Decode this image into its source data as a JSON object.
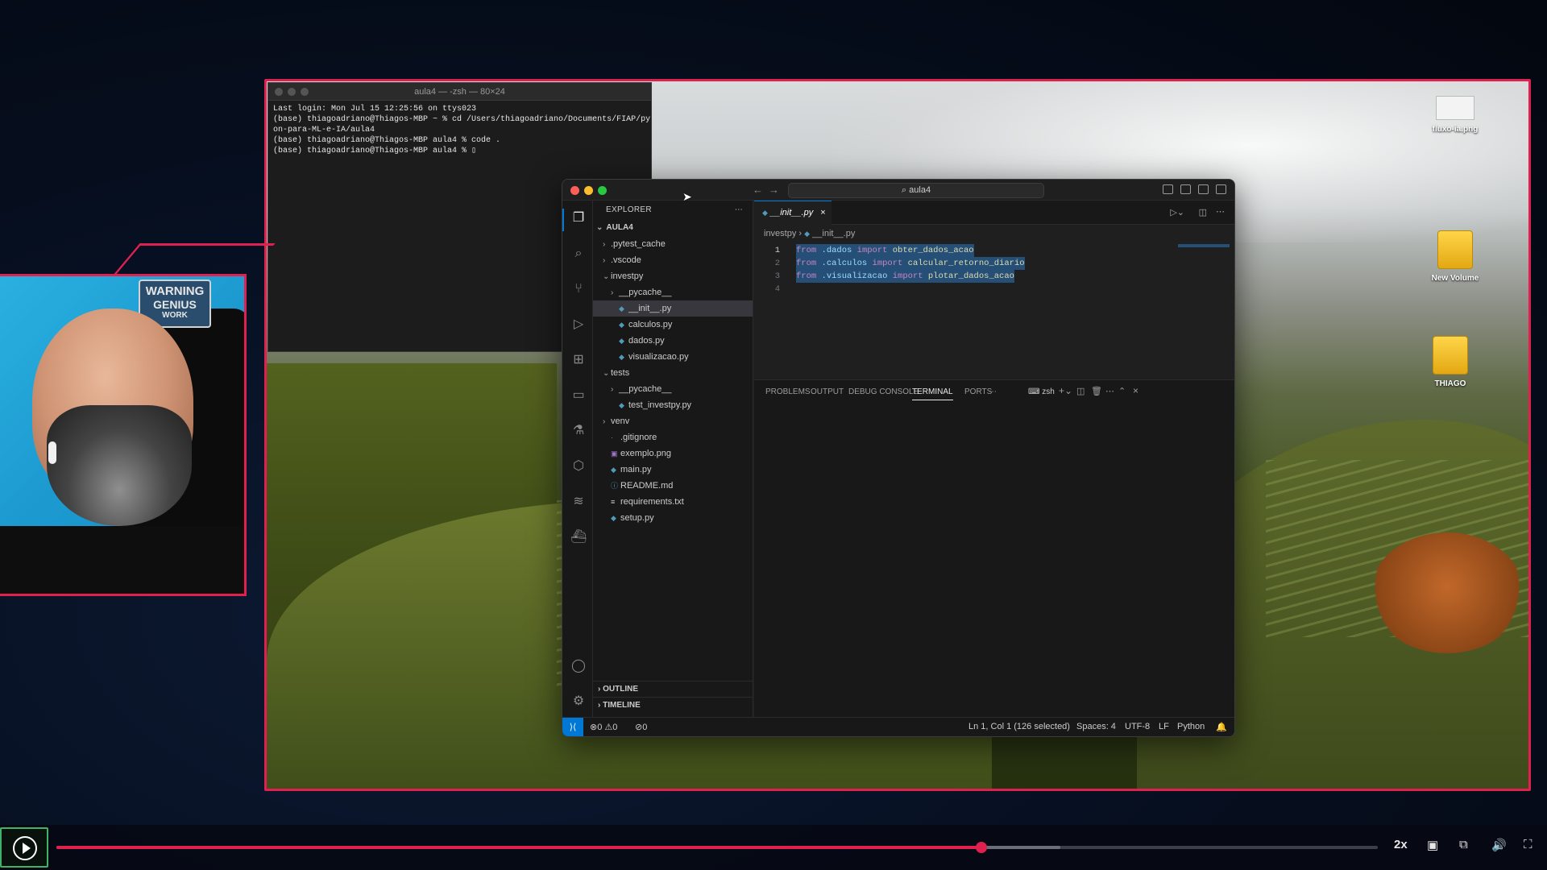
{
  "terminal": {
    "title": "aula4 — -zsh — 80×24",
    "lines": [
      "Last login: Mon Jul 15 12:25:56 on ttys023",
      "(base) thiagoadriano@Thiagos-MBP ~ % cd /Users/thiagoadriano/Documents/FIAP/pyth",
      "on-para-ML-e-IA/aula4",
      "(base) thiagoadriano@Thiagos-MBP aula4 % code .",
      "(base) thiagoadriano@Thiagos-MBP aula4 % ▯"
    ]
  },
  "vscode": {
    "search": "aula4",
    "explorer_title": "EXPLORER",
    "root": "AULA4",
    "tree": [
      {
        "label": ".pytest_cache",
        "type": "folder",
        "depth": 1,
        "open": false
      },
      {
        "label": ".vscode",
        "type": "folder",
        "depth": 1,
        "open": false
      },
      {
        "label": "investpy",
        "type": "folder",
        "depth": 1,
        "open": true
      },
      {
        "label": "__pycache__",
        "type": "folder",
        "depth": 2,
        "open": false
      },
      {
        "label": "__init__.py",
        "type": "py",
        "depth": 2,
        "selected": true
      },
      {
        "label": "calculos.py",
        "type": "py",
        "depth": 2
      },
      {
        "label": "dados.py",
        "type": "py",
        "depth": 2
      },
      {
        "label": "visualizacao.py",
        "type": "py",
        "depth": 2
      },
      {
        "label": "tests",
        "type": "folder",
        "depth": 1,
        "open": true
      },
      {
        "label": "__pycache__",
        "type": "folder",
        "depth": 2,
        "open": false
      },
      {
        "label": "test_investpy.py",
        "type": "py",
        "depth": 2
      },
      {
        "label": "venv",
        "type": "folder",
        "depth": 1,
        "open": false
      },
      {
        "label": ".gitignore",
        "type": "file",
        "depth": 1
      },
      {
        "label": "exemplo.png",
        "type": "img",
        "depth": 1
      },
      {
        "label": "main.py",
        "type": "py",
        "depth": 1
      },
      {
        "label": "README.md",
        "type": "md",
        "depth": 1
      },
      {
        "label": "requirements.txt",
        "type": "txt",
        "depth": 1
      },
      {
        "label": "setup.py",
        "type": "py",
        "depth": 1
      }
    ],
    "outline": "OUTLINE",
    "timeline": "TIMELINE",
    "tab": "__init__.py",
    "breadcrumb_folder": "investpy",
    "breadcrumb_file": "__init__.py",
    "code": [
      {
        "n": "1",
        "kw1": "from",
        "mod": " .dados ",
        "kw2": "import",
        "fn": " obter_dados_acao"
      },
      {
        "n": "2",
        "kw1": "from",
        "mod": " .calculos ",
        "kw2": "import",
        "fn": " calcular_retorno_diario"
      },
      {
        "n": "3",
        "kw1": "from",
        "mod": " .visualizacao ",
        "kw2": "import",
        "fn": " plotar_dados_acao"
      },
      {
        "n": "4",
        "kw1": "",
        "mod": "",
        "kw2": "",
        "fn": ""
      }
    ],
    "panel_tabs": [
      "PROBLEMS",
      "OUTPUT",
      "DEBUG CONSOLE",
      "TERMINAL",
      "PORTS"
    ],
    "panel_active": "TERMINAL",
    "panel_shell": "zsh",
    "status": {
      "errors": "0",
      "warnings": "0",
      "ports": "0",
      "position": "Ln 1, Col 1 (126 selected)",
      "spaces": "Spaces: 4",
      "encoding": "UTF-8",
      "eol": "LF",
      "language": "Python"
    }
  },
  "desktop_icons": [
    {
      "label": "fluxo-ia.png",
      "icon": "image-file-icon"
    },
    {
      "label": "New Volume",
      "icon": "drive-icon"
    },
    {
      "label": "THIAGO",
      "icon": "drive-icon"
    }
  ],
  "webcam": {
    "sign_line1": "WARNING",
    "sign_line2": "GENIUS",
    "sign_line3": "WORK"
  },
  "player": {
    "progress": 0.7,
    "buffered": 0.76,
    "speed": "2x"
  },
  "colors": {
    "accent": "#e0214f",
    "vscode_blue": "#0078d4",
    "play_green": "#3fb36a"
  }
}
